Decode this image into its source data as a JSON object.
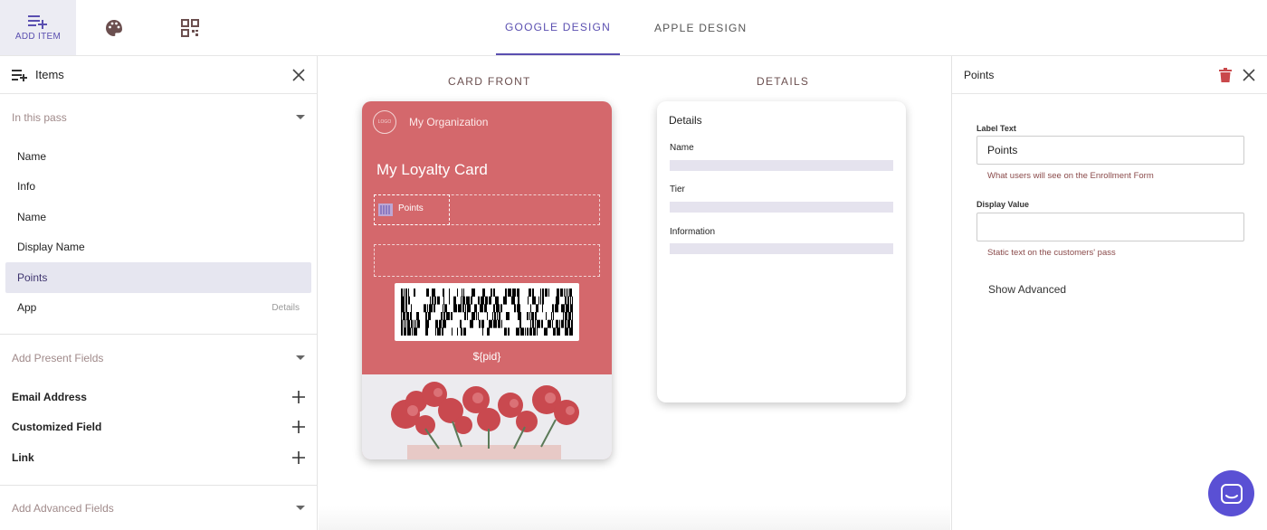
{
  "toolbar": {
    "add_item_label": "ADD ITEM",
    "tabs": [
      "GOOGLE DESIGN",
      "APPLE DESIGN"
    ],
    "accent": "#5a4fb0"
  },
  "left": {
    "title": "Items",
    "in_pass_label": "In this pass",
    "items": [
      {
        "label": "Name",
        "sub": ""
      },
      {
        "label": "Info",
        "sub": ""
      },
      {
        "label": "Name",
        "sub": ""
      },
      {
        "label": "Display Name",
        "sub": ""
      },
      {
        "label": "Points",
        "sub": ""
      },
      {
        "label": "App",
        "sub": "Details"
      }
    ],
    "present_label": "Add Present Fields",
    "present_items": [
      "Email Address",
      "Customized Field",
      "Link"
    ],
    "advanced_label": "Add Advanced Fields"
  },
  "center": {
    "front_title": "CARD FRONT",
    "details_title": "DETAILS",
    "card": {
      "logo_text": "LOGO",
      "org": "My Organization",
      "title": "My Loyalty Card",
      "points_label": "Points",
      "pid": "${pid}",
      "color": "#d4686c"
    },
    "details": {
      "header": "Details",
      "fields": [
        "Name",
        "Tier",
        "Information"
      ]
    }
  },
  "right": {
    "title": "Points",
    "label_text_caption": "Label Text",
    "label_text_value": "Points",
    "label_text_hint": "What users will see on the Enrollment Form",
    "display_value_caption": "Display Value",
    "display_value_value": "",
    "display_value_hint": "Static text on the customers' pass",
    "show_advanced": "Show Advanced"
  }
}
